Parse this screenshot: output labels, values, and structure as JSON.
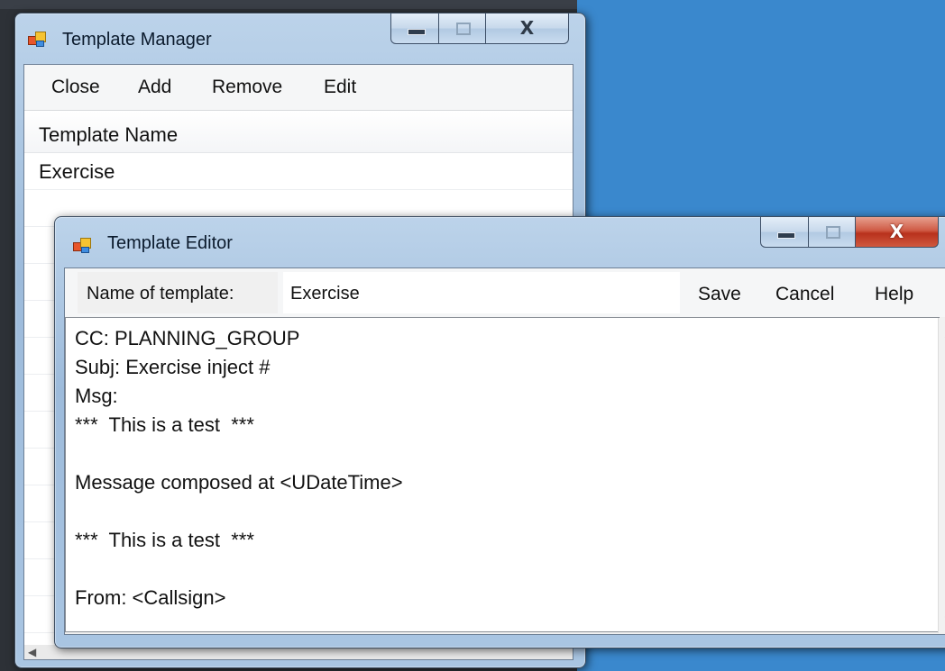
{
  "template_manager": {
    "title": "Template Manager",
    "menu": {
      "close": "Close",
      "add": "Add",
      "remove": "Remove",
      "edit": "Edit"
    },
    "list": {
      "column_header": "Template Name",
      "rows": [
        "Exercise"
      ]
    }
  },
  "template_editor": {
    "title": "Template Editor",
    "toolbar": {
      "name_label": "Name of template:",
      "name_value": "Exercise",
      "save": "Save",
      "cancel": "Cancel",
      "help": "Help"
    },
    "body_lines": [
      "CC: PLANNING_GROUP",
      "Subj: Exercise inject #",
      "Msg:",
      "***  This is a test  ***",
      "",
      "Message composed at <UDateTime>",
      "",
      "***  This is a test  ***",
      "",
      "From: <Callsign>"
    ]
  },
  "icons": {
    "app_icon": "windows-forms-icon",
    "minimize": "minimize-icon",
    "maximize": "maximize-icon",
    "close": "close-icon",
    "close_glyph": "X"
  },
  "colors": {
    "desktop": "#3a88cd",
    "close_active": "#c8412a"
  }
}
